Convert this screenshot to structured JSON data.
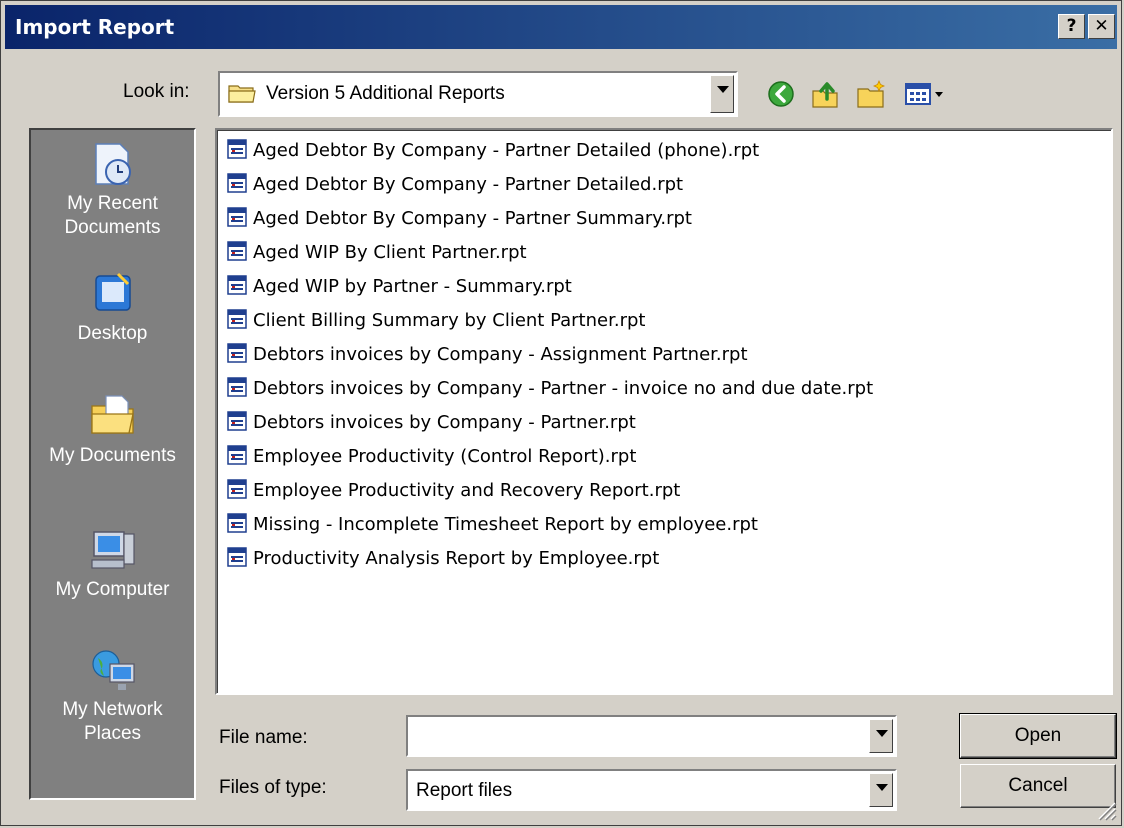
{
  "window": {
    "title": "Import Report",
    "help_btn": "?",
    "close_btn": "✕"
  },
  "lookin": {
    "label": "Look in:",
    "value": "Version 5 Additional Reports"
  },
  "toolbar": {
    "icons": [
      "back-icon",
      "up-folder-icon",
      "new-folder-icon",
      "view-menu-icon"
    ]
  },
  "places": [
    {
      "label": "My Recent Documents",
      "line1": "My Recent",
      "line2": "Documents",
      "icon": "recent-documents-icon"
    },
    {
      "label": "Desktop",
      "line1": "Desktop",
      "line2": "",
      "icon": "desktop-icon"
    },
    {
      "label": "My Documents",
      "line1": "My Documents",
      "line2": "",
      "icon": "my-documents-icon"
    },
    {
      "label": "My Computer",
      "line1": "My Computer",
      "line2": "",
      "icon": "my-computer-icon"
    },
    {
      "label": "My Network Places",
      "line1": "My Network",
      "line2": "Places",
      "icon": "network-places-icon"
    }
  ],
  "files": [
    "Aged Debtor By Company - Partner Detailed (phone).rpt",
    "Aged Debtor By Company - Partner Detailed.rpt",
    "Aged Debtor By Company - Partner Summary.rpt",
    "Aged WIP By Client Partner.rpt",
    "Aged WIP by Partner - Summary.rpt",
    "Client Billing Summary by Client Partner.rpt",
    "Debtors invoices by Company - Assignment Partner.rpt",
    "Debtors invoices by Company - Partner - invoice no and due date.rpt",
    "Debtors invoices by Company - Partner.rpt",
    "Employee Productivity (Control Report).rpt",
    "Employee Productivity and Recovery Report.rpt",
    "Missing - Incomplete Timesheet Report by employee.rpt",
    "Productivity Analysis Report by Employee.rpt"
  ],
  "filename": {
    "label": "File name:",
    "value": ""
  },
  "filetype": {
    "label": "Files of type:",
    "value": "Report files"
  },
  "buttons": {
    "open": "Open",
    "cancel": "Cancel"
  }
}
